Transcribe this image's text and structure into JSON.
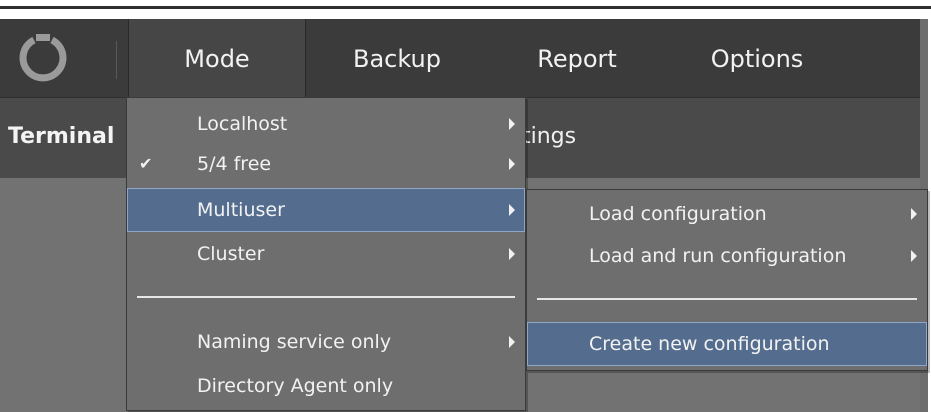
{
  "menubar": {
    "items": [
      {
        "label": "Mode"
      },
      {
        "label": "Backup"
      },
      {
        "label": "Report"
      },
      {
        "label": "Options"
      }
    ]
  },
  "toolbar": {
    "terminal_label": "Terminal",
    "settings_label_partial": "tings"
  },
  "mode_menu": {
    "items": [
      {
        "label": "Localhost",
        "has_submenu": true,
        "checked": false
      },
      {
        "label": "5/4 free",
        "has_submenu": true,
        "checked": true
      },
      {
        "label": "Multiuser",
        "has_submenu": true,
        "checked": false,
        "selected": true
      },
      {
        "label": "Cluster",
        "has_submenu": true,
        "checked": false
      },
      {
        "label": "Naming service only",
        "has_submenu": true,
        "checked": false
      },
      {
        "label": "Directory Agent only",
        "has_submenu": false,
        "checked": false
      }
    ]
  },
  "multiuser_submenu": {
    "items": [
      {
        "label": "Load configuration",
        "has_submenu": true
      },
      {
        "label": "Load and run configuration",
        "has_submenu": true
      },
      {
        "label": "Create new configuration",
        "has_submenu": false,
        "selected": true
      }
    ]
  },
  "colors": {
    "menubar_bg": "#3b3b3b",
    "menu_bg": "#6e6e6e",
    "selection_bg": "#546d8e",
    "selection_border": "#8fa7c4",
    "text": "#f2f2f2"
  },
  "icons": {
    "logo": "ring-logo-icon",
    "check": "checkmark-icon",
    "submenu_arrow": "chevron-right-icon"
  }
}
